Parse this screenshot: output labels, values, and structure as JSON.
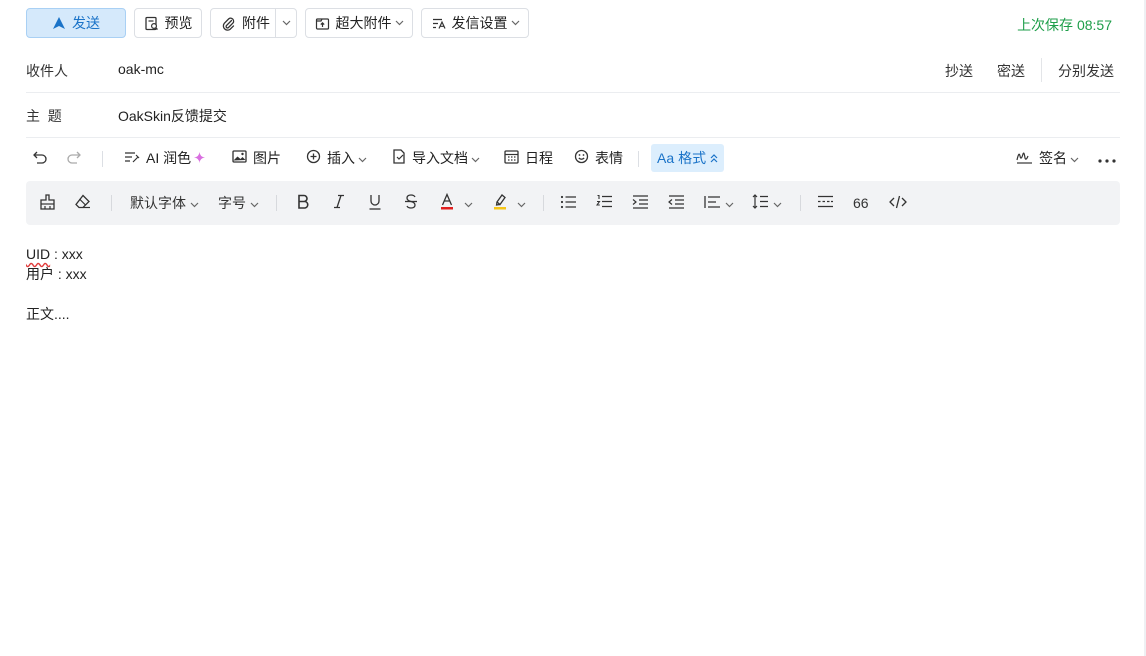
{
  "toolbar": {
    "send_label": "发送",
    "preview_label": "预览",
    "attach_label": "附件",
    "big_attach_label": "超大附件",
    "send_settings_label": "发信设置",
    "last_saved": "上次保存 08:57"
  },
  "recipients": {
    "label": "收件人",
    "value": "oak-mc",
    "cc_label": "抄送",
    "bcc_label": "密送",
    "separate_label": "分别发送"
  },
  "subject": {
    "label": "主  题",
    "value": "OakSkin反馈提交"
  },
  "editor_toolbar": {
    "ai_label": "AI 润色",
    "image_label": "图片",
    "insert_label": "插入",
    "import_label": "导入文档",
    "schedule_label": "日程",
    "emoji_label": "表情",
    "format_label": "格式",
    "format_prefix": "Aa",
    "signature_label": "签名"
  },
  "format_toolbar": {
    "font_label": "默认字体",
    "size_label": "字号",
    "quote_label": "66",
    "font_color": "#e02020",
    "highlight_color": "#f5c518"
  },
  "body": {
    "line1_key": "UID",
    "line1_rest": " : xxx",
    "line2": "用户 : xxx",
    "line3": "正文...."
  },
  "colors": {
    "accent": "#1a73c8",
    "save_green": "#1e9e4a"
  }
}
